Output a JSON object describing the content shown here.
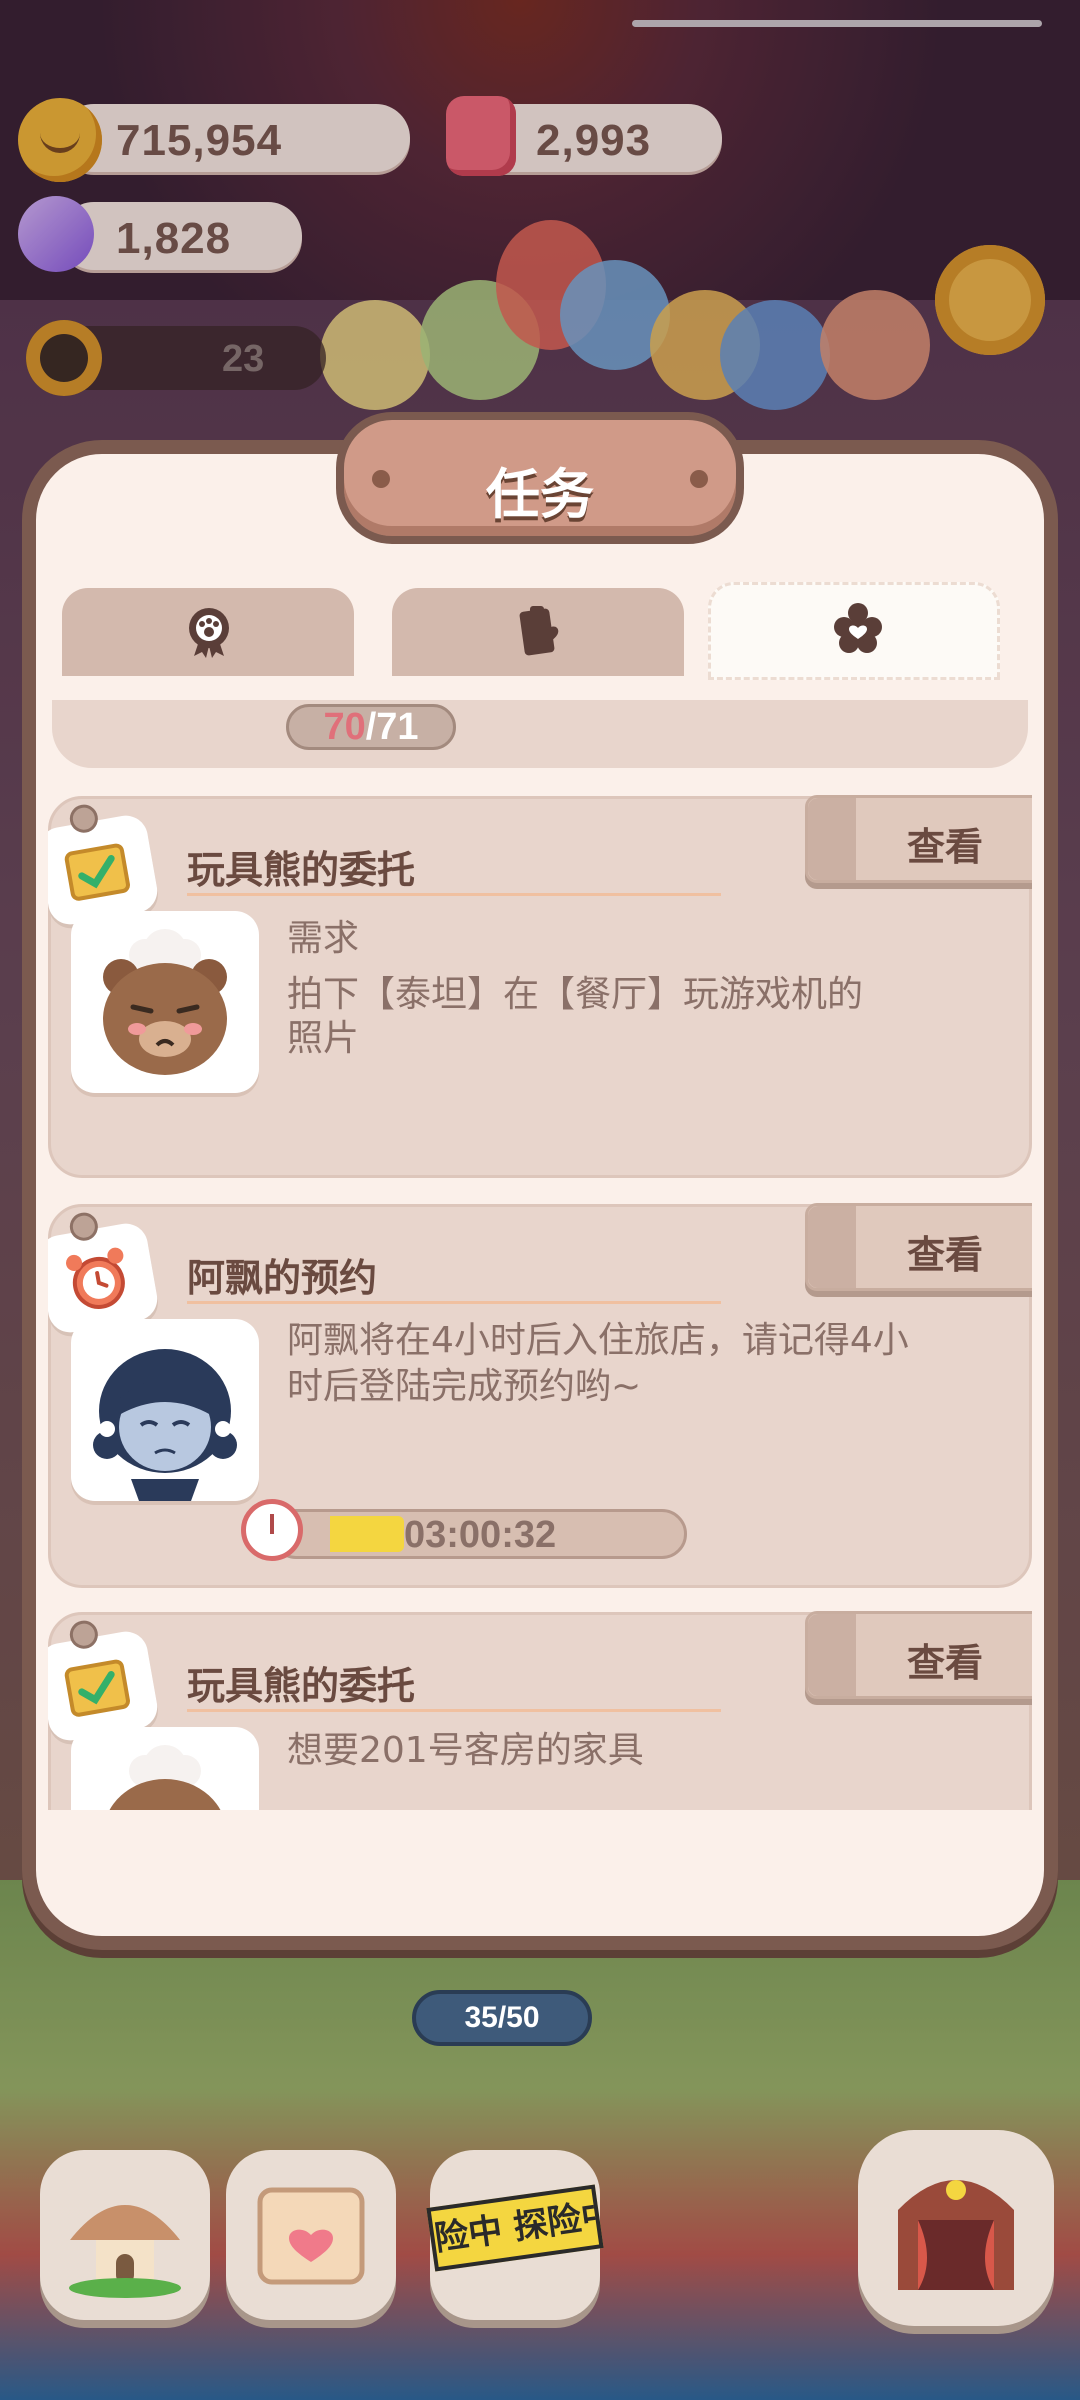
{
  "status_bar": {},
  "resources": {
    "cookies": "715,954",
    "gems": "2,993",
    "candy": "1,828",
    "counter": "23"
  },
  "dialog": {
    "title": "任务",
    "tabs": [
      {
        "icon": "paw-medal-icon",
        "active": false
      },
      {
        "icon": "clipboard-heart-icon",
        "active": false
      },
      {
        "icon": "flower-heart-icon",
        "active": true
      }
    ],
    "progress": {
      "current": "70",
      "separator": "/",
      "total": "71"
    },
    "tasks": [
      {
        "tag_icon": "check-note-icon",
        "title": "玩具熊的委托",
        "button": "查看",
        "avatar": "teddy-bear-avatar",
        "line1": "需求",
        "line2": "拍下【泰坦】在【餐厅】玩游戏机的",
        "line3": "照片"
      },
      {
        "tag_icon": "alarm-clock-icon",
        "title": "阿飘的预约",
        "button": "查看",
        "avatar": "ghost-girl-avatar",
        "line1": "阿飘将在4小时后入住旅店，请记得4小",
        "line2": "时后登陆完成预约哟~",
        "timer": "03:00:32",
        "timer_progress": 0.18
      },
      {
        "tag_icon": "check-note-icon",
        "title": "玩具熊的委托",
        "button": "查看",
        "avatar": "teddy-bear-avatar",
        "line1": "想要201号客房的家具"
      }
    ]
  },
  "background": {
    "badge": "35/50",
    "explore_banner": "险中 探险中"
  },
  "colors": {
    "panel": "#fbf0ea",
    "panel_border": "#7b5a4f",
    "card": "#e8d5cc",
    "title_plate": "#d09a88",
    "progress_current": "#e0707a",
    "timer_fill": "#f4d640"
  }
}
